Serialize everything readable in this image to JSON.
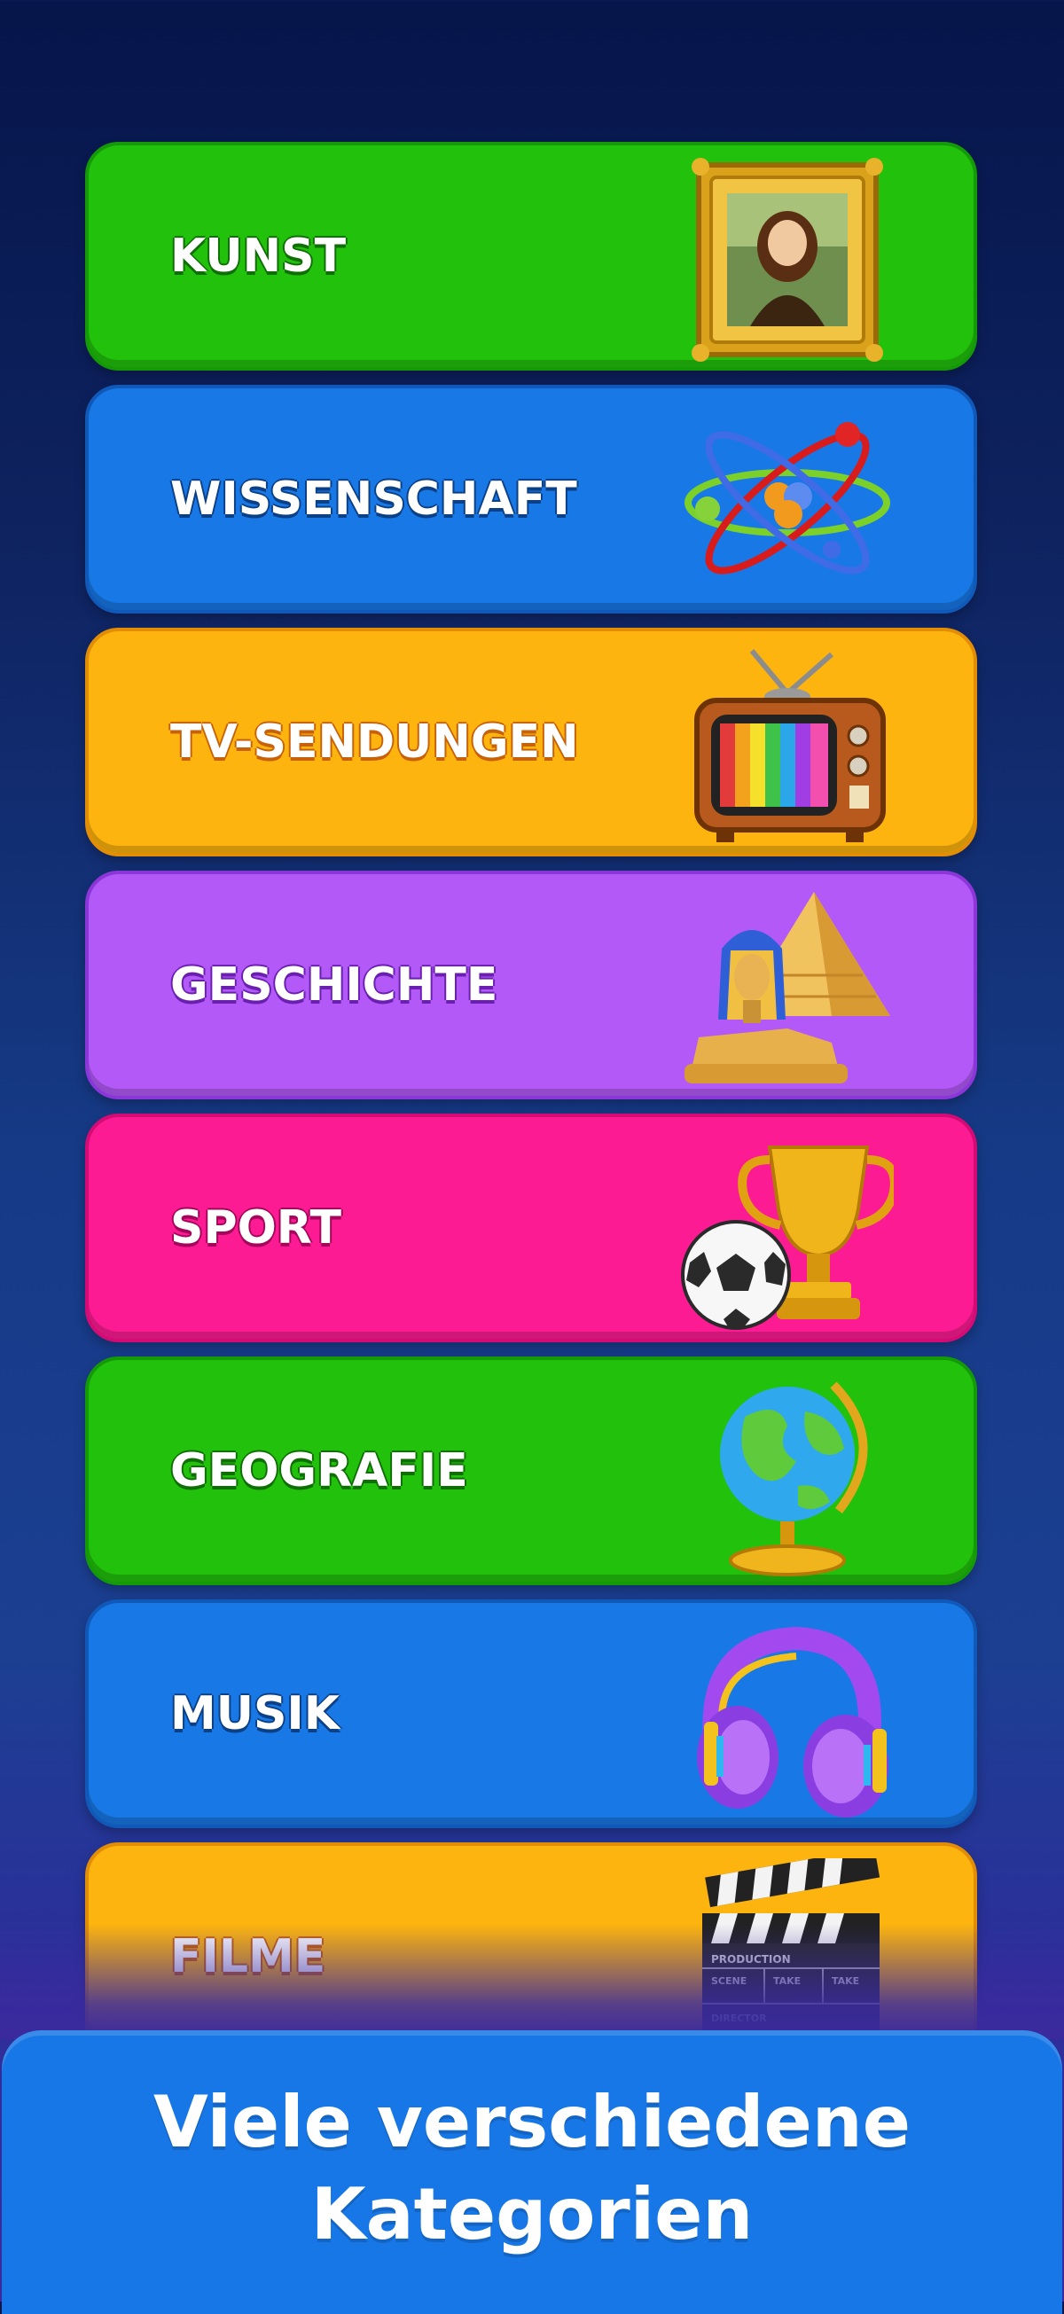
{
  "categories": [
    {
      "label": "KUNST",
      "color": "#22c10c",
      "border": "#159a07",
      "text_shadow": "#0f6e05",
      "icon": "framed-painting-icon"
    },
    {
      "label": "WISSENSCHAFT",
      "color": "#1878e6",
      "border": "#1059b8",
      "text_shadow": "#0b3f86",
      "icon": "atom-icon"
    },
    {
      "label": "TV-SENDUNGEN",
      "color": "#fdb40e",
      "border": "#e38d05",
      "text_shadow": "#c8620a",
      "icon": "retro-tv-icon"
    },
    {
      "label": "GESCHICHTE",
      "color": "#b259f7",
      "border": "#8b36d8",
      "text_shadow": "#6a1fb0",
      "icon": "sphinx-pyramid-icon"
    },
    {
      "label": "SPORT",
      "color": "#fd1b94",
      "border": "#d40b74",
      "text_shadow": "#a3065a",
      "icon": "trophy-football-icon"
    },
    {
      "label": "GEOGRAFIE",
      "color": "#22c10c",
      "border": "#159a07",
      "text_shadow": "#0f6e05",
      "icon": "globe-icon"
    },
    {
      "label": "MUSIK",
      "color": "#1878e6",
      "border": "#1059b8",
      "text_shadow": "#0b3f86",
      "icon": "headphones-icon"
    },
    {
      "label": "FILME",
      "color": "#fdb40e",
      "border": "#e38d05",
      "text_shadow": "#c8620a",
      "icon": "clapperboard-icon"
    }
  ],
  "clapperboard": {
    "top": "PRODUCTION",
    "scene": "SCENE",
    "take1": "TAKE",
    "take2": "TAKE",
    "director": "DIRECTOR"
  },
  "banner": {
    "line1": "Viele verschiedene",
    "line2": "Kategorien"
  }
}
